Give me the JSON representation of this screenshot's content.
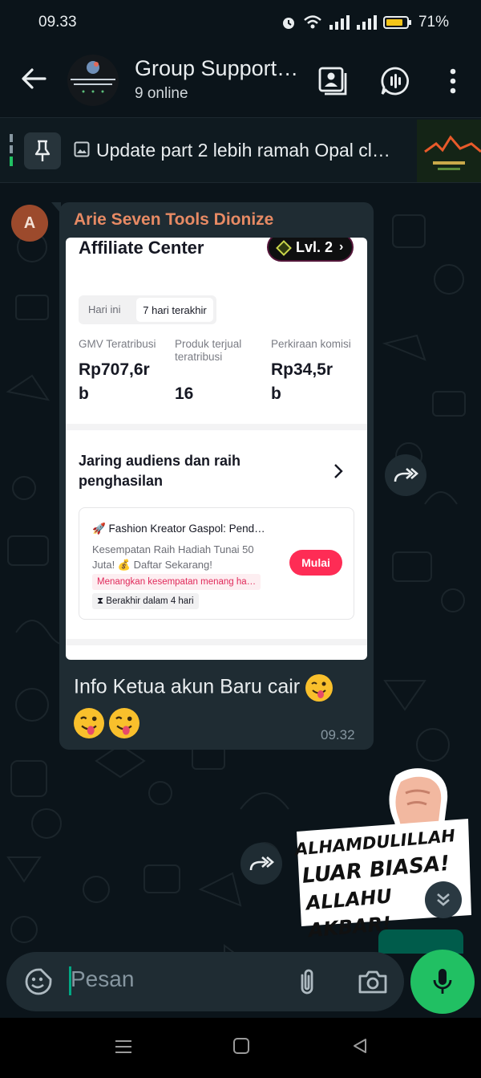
{
  "status_bar": {
    "time": "09.33",
    "battery": "71%"
  },
  "header": {
    "title": "Group Support…",
    "subtitle": "9 online",
    "avatar_caption_1": "Group Support | Dionize Story",
    "avatar_caption_2": "Produk Generator"
  },
  "pinned": {
    "text": "Update part 2 lebih ramah Opal cl…"
  },
  "message": {
    "avatar_letter": "A",
    "sender": "Arie Seven Tools Dionize",
    "caption": "Info Ketua akun Baru cair",
    "time": "09.32",
    "screenshot": {
      "title": "Affiliate Center",
      "level": "Lvl. 2",
      "tab_1": "Hari ini",
      "tab_2": "7 hari terakhir",
      "metrics": [
        {
          "label": "GMV Teratribusi",
          "value_1": "Rp707,6r",
          "value_2": "b"
        },
        {
          "label_1": "Produk terjual",
          "label_2": "teratribusi",
          "value": "16"
        },
        {
          "label": "Perkiraan komisi",
          "value_1": "Rp34,5r",
          "value_2": "b"
        }
      ],
      "section_title_1": "Jaring audiens dan raih",
      "section_title_2": "penghasilan",
      "card": {
        "title": "🚀 Fashion Kreator Gaspol: Pend…",
        "desc_1": "Kesempatan Raih Hadiah Tunai 50",
        "desc_2": "Juta! 💰 Daftar Sekarang!",
        "tag": "Menangkan kesempatan menang ha…",
        "deadline": "Berakhir dalam 4 hari",
        "button": "Mulai"
      }
    }
  },
  "sticker": {
    "line_1": "ALHAMDULILLAH",
    "line_2": "LUAR BIASA!",
    "line_3": "ALLAHU AKBAR!"
  },
  "composer": {
    "placeholder": "Pesan"
  },
  "colors": {
    "accent_green": "#21c063",
    "bubble": "#1f2c33",
    "background": "#0b141a",
    "sender_name": "#e78a64",
    "tiktok_red": "#fe2c55"
  }
}
